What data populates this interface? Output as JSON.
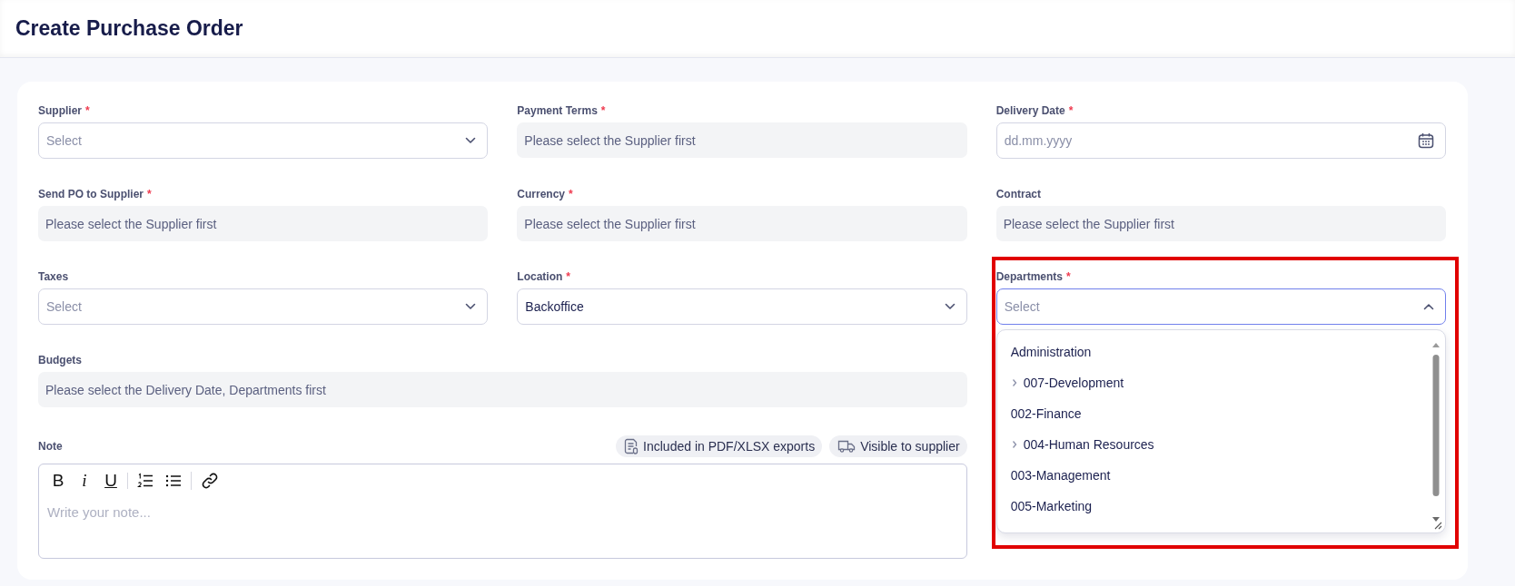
{
  "title": "Create Purchase Order",
  "fields": [
    {
      "label": "Supplier",
      "required_mark": "*",
      "kind": "select",
      "placeholder": "Select"
    },
    {
      "label": "Payment Terms",
      "required_mark": "*",
      "kind": "readonly",
      "placeholder": "Please select the Supplier first"
    },
    {
      "label": "Delivery Date",
      "required_mark": "*",
      "kind": "date",
      "placeholder": "dd.mm.yyyy"
    },
    {
      "label": "Send PO to Supplier",
      "required_mark": "*",
      "kind": "readonly",
      "placeholder": "Please select the Supplier first"
    },
    {
      "label": "Currency",
      "required_mark": "*",
      "kind": "readonly",
      "placeholder": "Please select the Supplier first"
    },
    {
      "label": "Contract",
      "kind": "readonly",
      "placeholder": "Please select the Supplier first"
    },
    {
      "label": "Taxes",
      "kind": "select",
      "placeholder": "Select"
    },
    {
      "label": "Location",
      "required_mark": "*",
      "kind": "select",
      "value": "Backoffice"
    },
    {
      "label": "Departments",
      "required_mark": "*",
      "kind": "select",
      "placeholder": "Select",
      "open": true,
      "highlighted": true,
      "options": [
        {
          "label": "Administration",
          "kind": "leaf"
        },
        {
          "label": "007-Development",
          "kind": "parent",
          "expanded": false
        },
        {
          "label": "002-Finance",
          "kind": "leaf"
        },
        {
          "label": "004-Human Resources",
          "kind": "parent",
          "expanded": false
        },
        {
          "label": "003-Management",
          "kind": "leaf"
        },
        {
          "label": "005-Marketing",
          "kind": "leaf"
        }
      ]
    },
    {
      "label": "Budgets",
      "kind": "readonly",
      "wide": true,
      "placeholder": "Please select the Delivery Date, Departments first"
    }
  ],
  "note": {
    "label": "Note",
    "chips": [
      {
        "kind": "export",
        "label": "Included in PDF/XLSX exports"
      },
      {
        "kind": "supplier",
        "label": "Visible to supplier"
      }
    ],
    "toolbar": [
      [
        {
          "kind": "bold",
          "label": "B"
        },
        {
          "kind": "italic",
          "label": "i"
        },
        {
          "kind": "underline",
          "label": "U"
        }
      ],
      [
        {
          "kind": "ordered-list"
        },
        {
          "kind": "bullet-list"
        }
      ],
      [
        {
          "kind": "link"
        }
      ]
    ],
    "placeholder": "Write your note..."
  }
}
